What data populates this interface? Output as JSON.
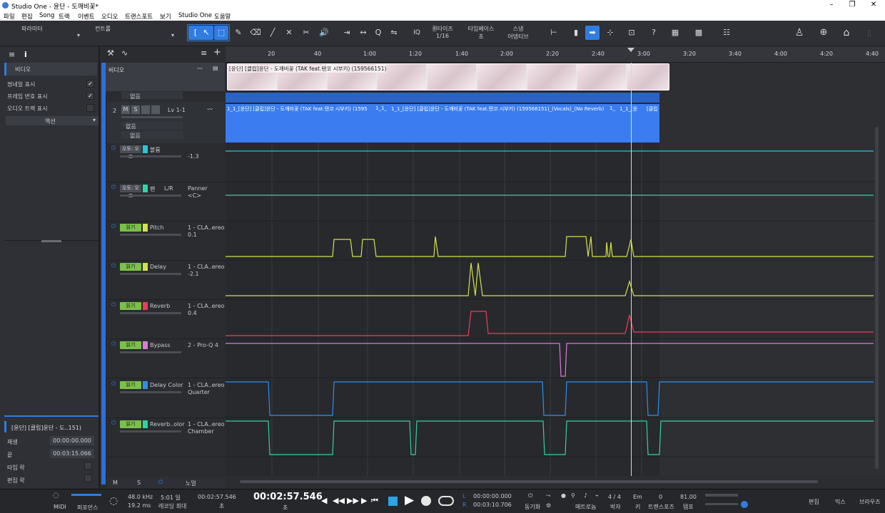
{
  "window": {
    "title": "Studio One - 윤단 - 도깨비꽃*"
  },
  "menu": [
    "파일",
    "편집",
    "Song",
    "트랙",
    "이벤트",
    "오디오",
    "트랜스포트",
    "보기",
    "Studio One",
    "도움말"
  ],
  "toolbar": {
    "param_label": "파라미터",
    "control_label": "컨트롤",
    "quantize_label": "퀀타이즈",
    "quantize_value": "1/16",
    "timebase_label": "타임베이스",
    "timebase_value": "초",
    "snap_label": "스냅",
    "snap_value": "어댑티브",
    "iq": "IQ",
    "help": "?"
  },
  "inspector": {
    "video_label": "비디오",
    "show_thumbnail": "썸네일 표시",
    "show_frame_number": "프레임 번호 표시",
    "show_audio_track": "오디오 트랙 표시",
    "action": "액션",
    "event_name": "[윤단] [클립]윤단 - 도..151)",
    "play_label": "재생",
    "play_value": "00:00:00.000",
    "end_label": "끝",
    "end_value": "00:03:15.066",
    "time_lock": "타임 락",
    "edit_lock": "편집 락"
  },
  "tracks": {
    "video_name": "비디오",
    "none1": "없음",
    "track_num": "2",
    "m": "M",
    "s": "S",
    "level": "Lv 1-1",
    "none2": "없음",
    "none3": "없음",
    "lanes": [
      {
        "name": "볼륨",
        "mode": "오토: 오프",
        "value": "-1.3",
        "sub": "",
        "color": "#25c6d6"
      },
      {
        "name": "팬",
        "mode": "오토: 오프",
        "value": "L/R",
        "sub": "Panner",
        "sub2": "<C>",
        "color": "#2bd6a6"
      },
      {
        "name": "Pitch",
        "mode": "읽기",
        "value": "0.1",
        "sub": "1 - CLA..ereo",
        "color": "#d4e14a"
      },
      {
        "name": "Delay",
        "mode": "읽기",
        "value": "-2.1",
        "sub": "1 - CLA..ereo",
        "color": "#d4e14a"
      },
      {
        "name": "Reverb",
        "mode": "읽기",
        "value": "0.4",
        "sub": "1 - CLA..ereo",
        "color": "#ef3b5c"
      },
      {
        "name": "Bypass",
        "mode": "읽기",
        "value": "",
        "sub": "2 - Pro-Q 4",
        "color": "#e07ad9"
      },
      {
        "name": "Delay Color",
        "mode": "읽기",
        "value": "Quarter",
        "sub": "1 - CLA..ereo",
        "color": "#2e8ff0"
      },
      {
        "name": "Reverb..olor",
        "mode": "읽기",
        "value": "Chamber",
        "sub": "1 - CLA..ereo",
        "color": "#2fd3a1"
      }
    ],
    "footer_m": "M",
    "footer_s": "S",
    "footer_note": "노멀"
  },
  "ruler": [
    "20",
    "40",
    "1:00",
    "1:20",
    "1:40",
    "2:00",
    "2:20",
    "2:40",
    "3:00",
    "3:20",
    "3:40",
    "4:00",
    "4:20",
    "4:40"
  ],
  "clips": {
    "video": "[윤단] [클립]윤단 - 도깨비꽃 (TAK feat.탠코 시부키) (159566151)",
    "audio1": "1_1_[윤단] [클립]윤단 - 도깨비꽃 (TAK feat.탠코 시부키) (1595",
    "audio2": "1_1_",
    "audio3": "1_1_[윤단] [클립]윤단 - 도깨비꽃 (TAK feat.탠코 시부키) (159566151)_(Vocals)_(No Reverb)",
    "audio4": "1_",
    "audio5": "1_1_[윤",
    "audio6": "[클립"
  },
  "transport": {
    "midi": "MIDI",
    "perf": "퍼포먼스",
    "rate": "48.0 kHz",
    "latency": "19.2 ms",
    "rec_time": "5:01 일",
    "rec_max": "레코딩 최대",
    "pos_small": "00:02:57.546",
    "pos_unit": "초",
    "pos_big": "00:02:57.546",
    "pos_unit2": "초",
    "L": "L",
    "R": "R",
    "loop_l": "00:00:00.000",
    "loop_r": "00:03:10.706",
    "sync": "동기화",
    "metronome": "메트로놈",
    "signature": "4 / 4",
    "beat": "박자",
    "key": "Em",
    "key_lbl": "키",
    "transpose": "0",
    "transpose_lbl": "트랜스포즈",
    "tempo": "81.00",
    "tempo_lbl": "템포",
    "edit": "편집",
    "mix": "믹스",
    "browse": "브라우즈"
  }
}
